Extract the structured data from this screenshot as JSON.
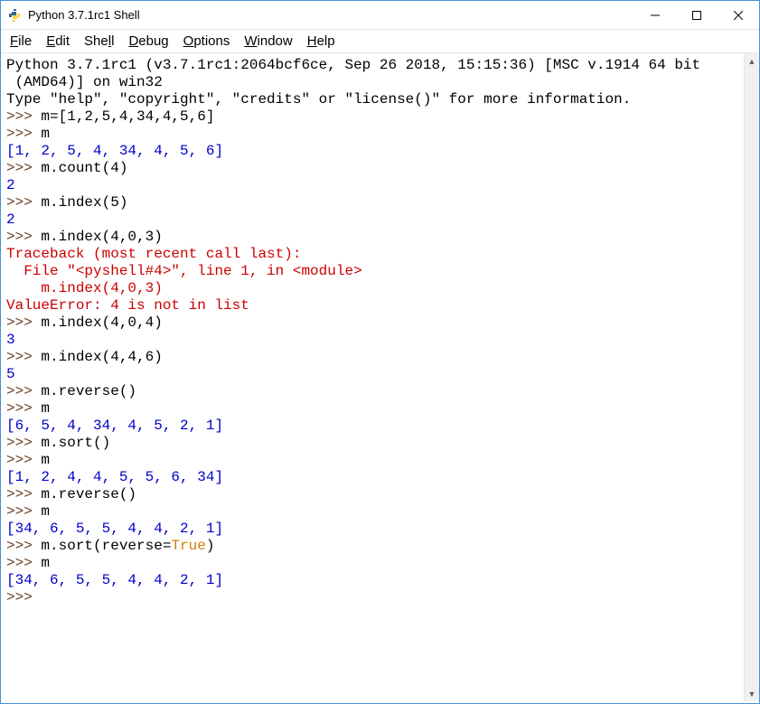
{
  "window": {
    "title": "Python 3.7.1rc1 Shell"
  },
  "menus": {
    "file": "File",
    "edit": "Edit",
    "shell": "Shell",
    "debug": "Debug",
    "options": "Options",
    "window": "Window",
    "help": "Help"
  },
  "banner": {
    "line1": "Python 3.7.1rc1 (v3.7.1rc1:2064bcf6ce, Sep 26 2018, 15:15:36) [MSC v.1914 64 bit",
    "line2": " (AMD64)] on win32",
    "line3": "Type \"help\", \"copyright\", \"credits\" or \"license()\" for more information."
  },
  "prompt": ">>> ",
  "session": {
    "in1": "m=[1,2,5,4,34,4,5,6]",
    "in2": "m",
    "out2": "[1, 2, 5, 4, 34, 4, 5, 6]",
    "in3": "m.count(4)",
    "out3": "2",
    "in4": "m.index(5)",
    "out4": "2",
    "in5": "m.index(4,0,3)",
    "err5_l1": "Traceback (most recent call last):",
    "err5_l2": "  File \"<pyshell#4>\", line 1, in <module>",
    "err5_l3": "    m.index(4,0,3)",
    "err5_l4": "ValueError: 4 is not in list",
    "in6": "m.index(4,0,4)",
    "out6": "3",
    "in7": "m.index(4,4,6)",
    "out7": "5",
    "in8": "m.reverse()",
    "in9": "m",
    "out9": "[6, 5, 4, 34, 4, 5, 2, 1]",
    "in10": "m.sort()",
    "in11": "m",
    "out11": "[1, 2, 4, 4, 5, 5, 6, 34]",
    "in12": "m.reverse()",
    "in13": "m",
    "out13": "[34, 6, 5, 5, 4, 4, 2, 1]",
    "in14_a": "m.sort(reverse=",
    "in14_kw": "True",
    "in14_b": ")",
    "in15": "m",
    "out15": "[34, 6, 5, 5, 4, 4, 2, 1]"
  }
}
